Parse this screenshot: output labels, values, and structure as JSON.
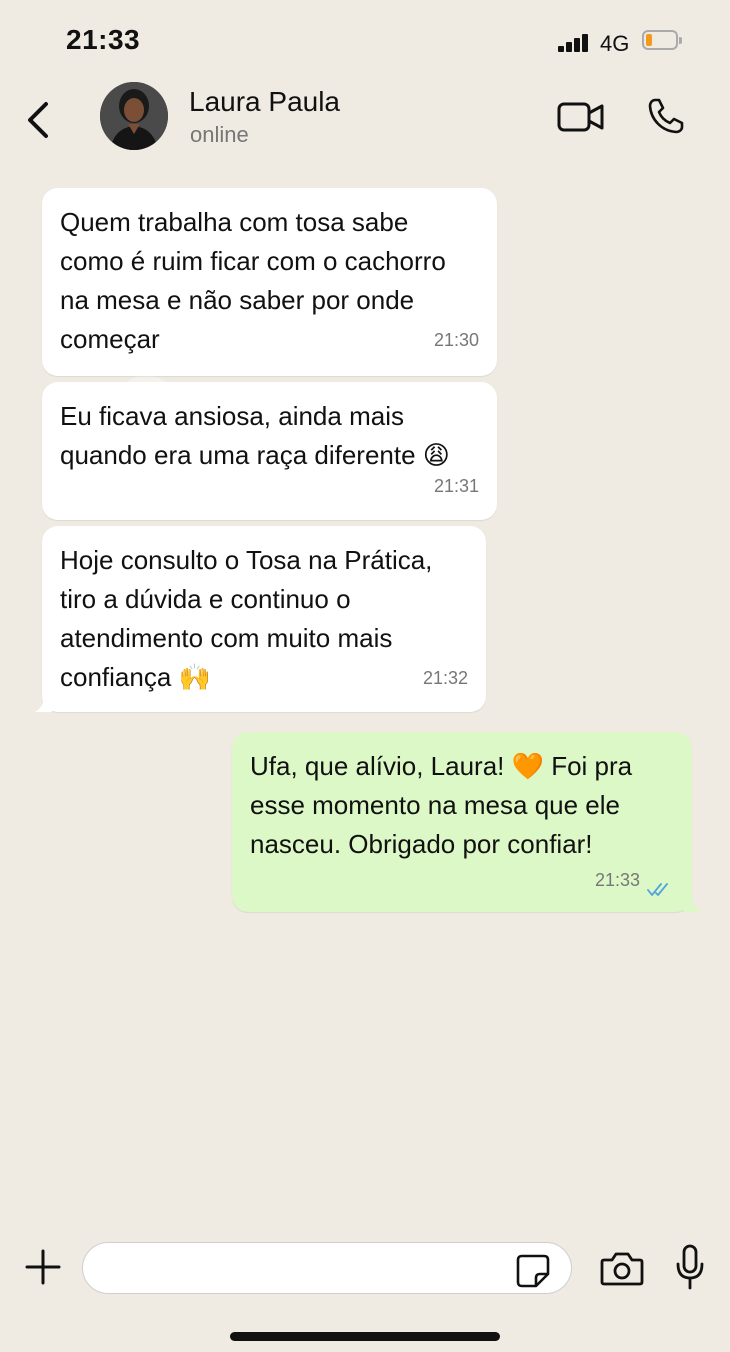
{
  "status_bar": {
    "time": "21:33",
    "network": "4G",
    "battery_color": "#f39a1e"
  },
  "header": {
    "contact_name": "Laura Paula",
    "contact_status": "online",
    "icons": [
      "back-chevron-icon",
      "video-camera-icon",
      "phone-icon"
    ]
  },
  "messages": [
    {
      "direction": "incoming",
      "text": "Quem  trabalha com tosa sabe\ncomo é ruim ficar com o cachorro\nna mesa e não saber por onde\ncomeçar",
      "time": "21:30"
    },
    {
      "direction": "incoming",
      "text": "Eu ficava ansiosa, ainda mais\nquando era uma raça diferente 😩",
      "time": "21:31"
    },
    {
      "direction": "incoming",
      "text": "Hoje consulto o Tosa na Prática,\ntiro a dúvida e continuo o\natendimento com muito mais\nconfiança 🙌",
      "time": "21:32"
    },
    {
      "direction": "outgoing",
      "text": "Ufa, que alívio, Laura! 🧡 Foi pra\nesse momento na mesa que ele\nnasceu. Obrigado por confiar!",
      "time": "21:33",
      "read": true
    }
  ],
  "colors": {
    "incoming_bubble": "#ffffff",
    "outgoing_bubble": "#dcf8c6",
    "read_ticks": "#4fa3e0",
    "background": "#efeae2"
  },
  "input": {
    "placeholder": ""
  }
}
